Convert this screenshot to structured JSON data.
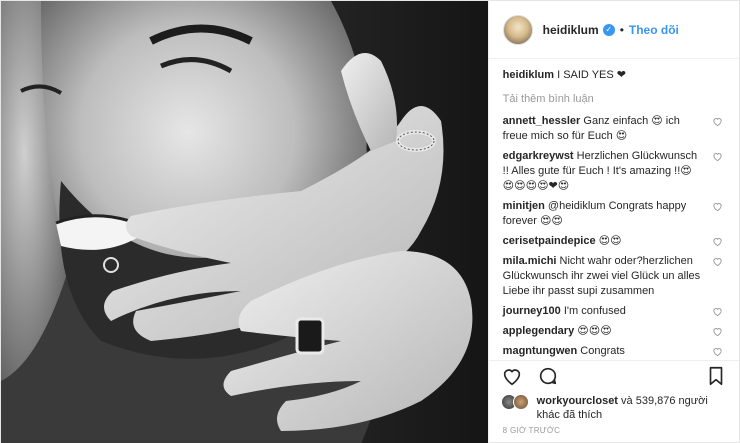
{
  "header": {
    "username": "heidiklum",
    "separator": "•",
    "follow_label": "Theo dõi"
  },
  "caption": {
    "username": "heidiklum",
    "text": "I SAID YES ❤"
  },
  "load_more_label": "Tải thêm bình luận",
  "comments": [
    {
      "username": "annett_hessler",
      "text": "Ganz einfach 😍 ich freue mich so für Euch 😍"
    },
    {
      "username": "edgarkreywst",
      "text": "Herzlichen Glückwunsch !! Alles gute für Euch ! It's amazing !!😍 😍😍😍😍❤😍"
    },
    {
      "username": "minitjen",
      "text": "@heidiklum Congrats happy forever 😍😍"
    },
    {
      "username": "cerisetpaindepice",
      "text": "😍😍"
    },
    {
      "username": "mila.michi",
      "text": "Nicht wahr oder?herzlichen Glückwunsch ihr zwei viel Glück un alles Liebe ihr passt supi zusammen"
    },
    {
      "username": "journey100",
      "text": "I'm confused"
    },
    {
      "username": "applegendary",
      "text": "😍😍😍"
    },
    {
      "username": "magntungwen",
      "text": "Congrats"
    }
  ],
  "likes": {
    "username": "workyourcloset",
    "rest": "và 539,876 người khác đã thích"
  },
  "timestamp": "8 giờ trước",
  "icons": {
    "like": "heart-icon",
    "comment": "comment-icon",
    "save": "bookmark-icon"
  },
  "colors": {
    "link_blue": "#3897f0",
    "muted_gray": "#999999",
    "text": "#262626"
  }
}
